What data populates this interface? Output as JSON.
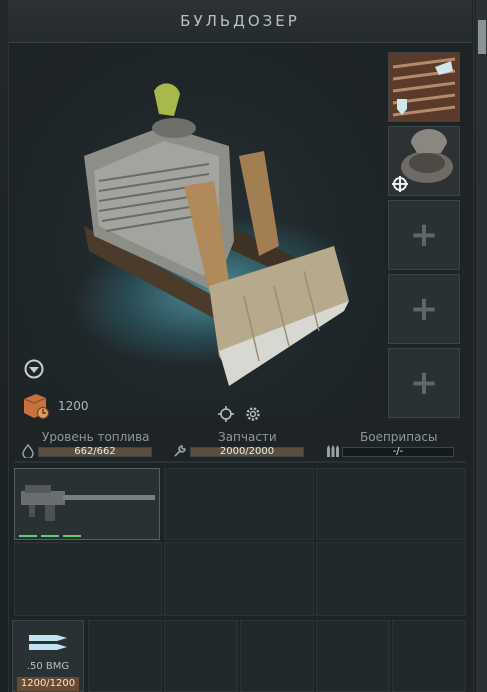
{
  "window": {
    "title": "БУЛЬДОЗЕР"
  },
  "vehicle": {
    "image_icon": "bulldozer-image",
    "resource_value": "1200",
    "resource_icon": "crate-icon"
  },
  "slots": [
    {
      "state": "filled",
      "icon": "armor-module-icon"
    },
    {
      "state": "filled",
      "icon": "turret-module-icon"
    },
    {
      "state": "empty",
      "plus": "+"
    },
    {
      "state": "empty",
      "plus": "+"
    },
    {
      "state": "empty",
      "plus": "+"
    }
  ],
  "stats": {
    "fuel": {
      "label": "Уровень топлива",
      "value": "662/662",
      "fraction": 1.0
    },
    "parts": {
      "label": "Запчасти",
      "value": "2000/2000",
      "fraction": 1.0
    },
    "ammo": {
      "label": "Боеприпасы",
      "value": "-/-",
      "fraction": 0.0
    }
  },
  "weapon": {
    "icon": "machine-gun-icon",
    "pips": 3
  },
  "ammo_item": {
    "name": ".50 BMG",
    "count": "1200/1200"
  },
  "colors": {
    "accent_glow": "#6edceb",
    "bar_fill": "#5a4f3e",
    "pip_green": "#5fcf6a",
    "ammo_badge": "#6a4a30"
  }
}
